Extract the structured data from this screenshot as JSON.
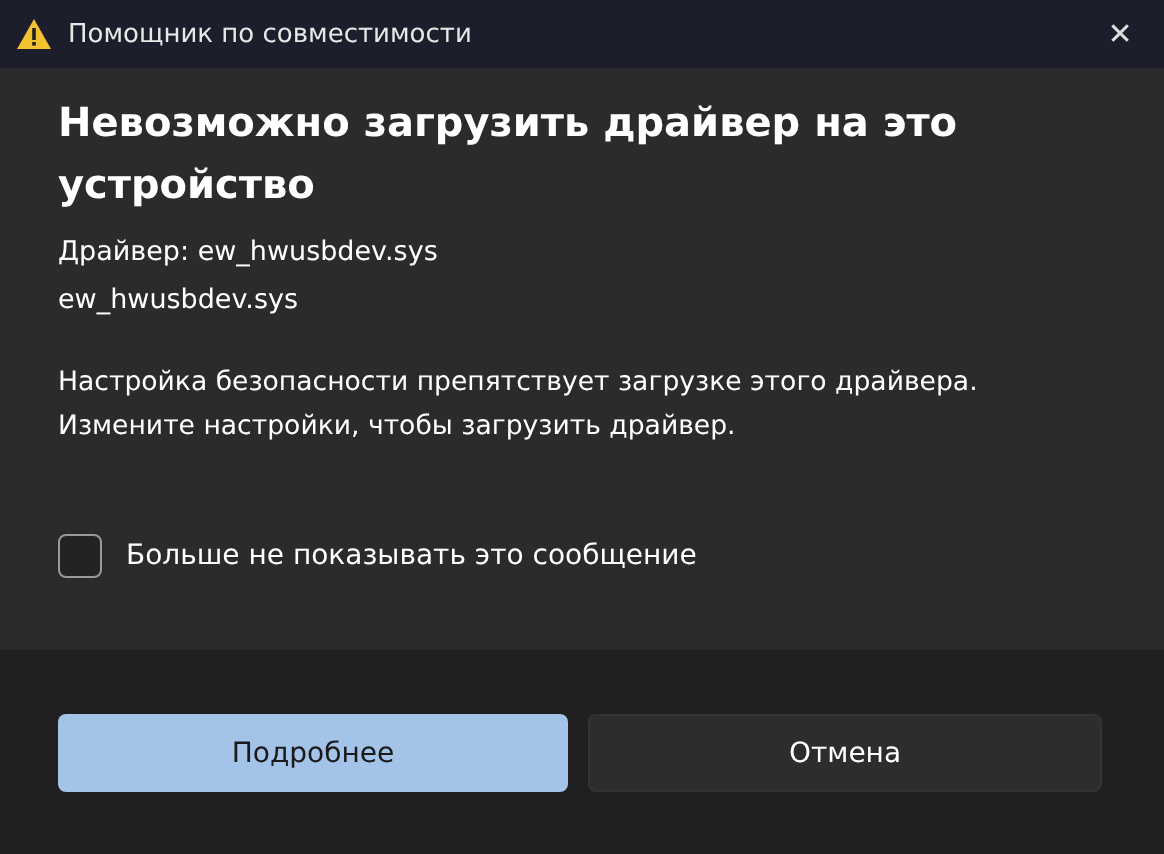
{
  "window": {
    "title": "Помощник по совместимости",
    "close": "✕"
  },
  "heading": "Невозможно загрузить драйвер на это устройство",
  "details": [
    "Драйвер: ew_hwusbdev.sys",
    "ew_hwusbdev.sys"
  ],
  "message": [
    "Настройка безопасности препятствует загрузке этого драйвера.",
    "Измените настройки, чтобы загрузить драйвер."
  ],
  "checkbox": {
    "label": "Больше не показывать это сообщение",
    "checked": false
  },
  "buttons": [
    {
      "label": "Подробнее",
      "kind": "primary"
    },
    {
      "label": "Отмена",
      "kind": "secondary"
    }
  ]
}
